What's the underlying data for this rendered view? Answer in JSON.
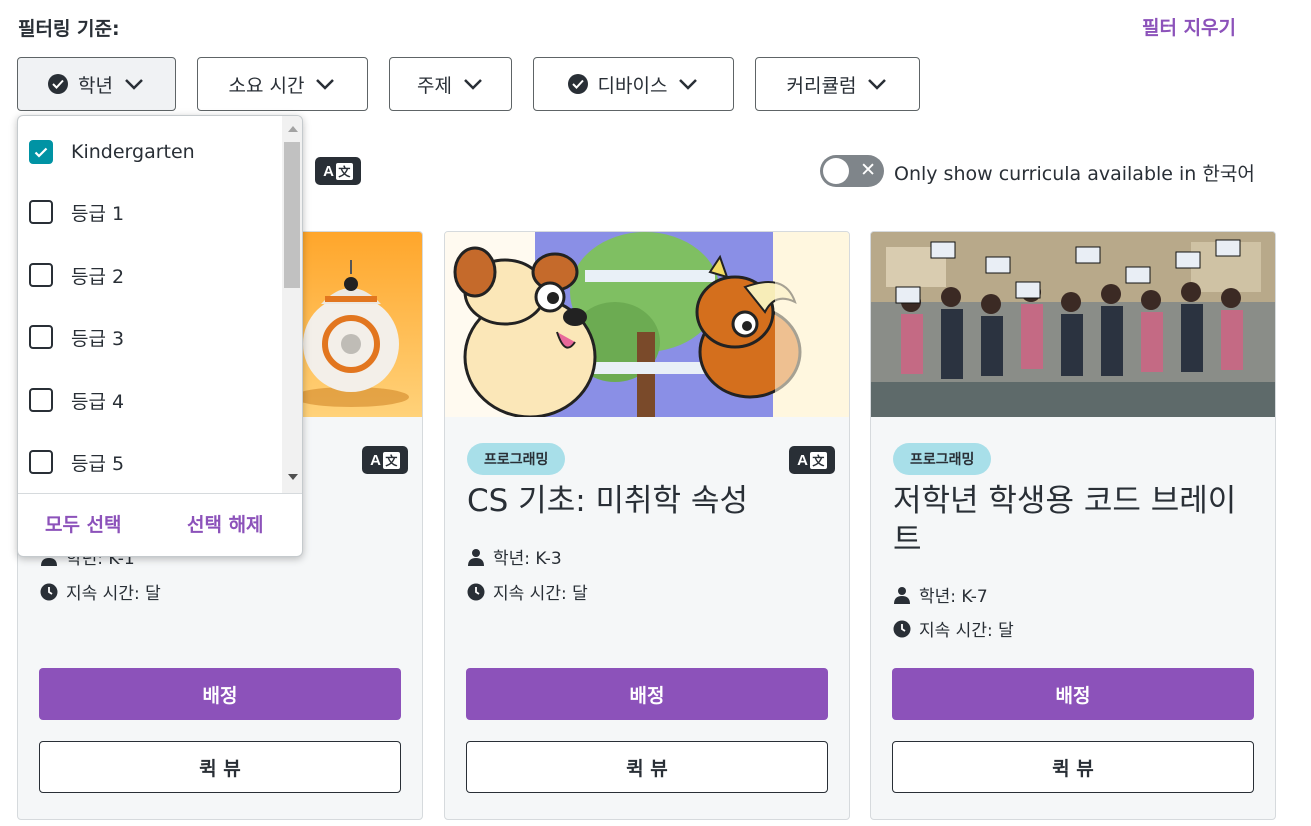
{
  "header": {
    "filter_label": "필터링 기준:",
    "clear_filters": "필터 지우기"
  },
  "filters": [
    {
      "label": "학년",
      "selected": true
    },
    {
      "label": "소요 시간",
      "selected": false
    },
    {
      "label": "주제",
      "selected": false
    },
    {
      "label": "디바이스",
      "selected": true
    },
    {
      "label": "커리큘럼",
      "selected": false
    }
  ],
  "toggle": {
    "label": "Only show curricula available in 한국어",
    "on": false,
    "off_symbol": "✕"
  },
  "lang_icon": {
    "a": "A",
    "k": "文"
  },
  "dropdown": {
    "items": [
      {
        "label": "Kindergarten",
        "checked": true
      },
      {
        "label": "등급 1",
        "checked": false
      },
      {
        "label": "등급 2",
        "checked": false
      },
      {
        "label": "등급 3",
        "checked": false
      },
      {
        "label": "등급 4",
        "checked": false
      },
      {
        "label": "등급 5",
        "checked": false
      }
    ],
    "select_all": "모두 선택",
    "deselect": "선택 해제"
  },
  "cards": [
    {
      "tag": "",
      "title": "",
      "grade": "학년: K-1",
      "duration": "지속 시간: 달",
      "assign": "배정",
      "quick_view": "퀵 뷰"
    },
    {
      "tag": "프로그래밍",
      "title": "CS 기초: 미취학 속성",
      "grade": "학년: K-3",
      "duration": "지속 시간: 달",
      "assign": "배정",
      "quick_view": "퀵 뷰"
    },
    {
      "tag": "프로그래밍",
      "title": "저학년 학생용 코드 브레이트",
      "grade": "학년: K-7",
      "duration": "지속 시간: 달",
      "assign": "배정",
      "quick_view": "퀵 뷰"
    }
  ],
  "colors": {
    "accent": "#8c52ba",
    "checkbox": "#0093a4",
    "pill": "#a8dfe9",
    "text": "#292f36"
  }
}
